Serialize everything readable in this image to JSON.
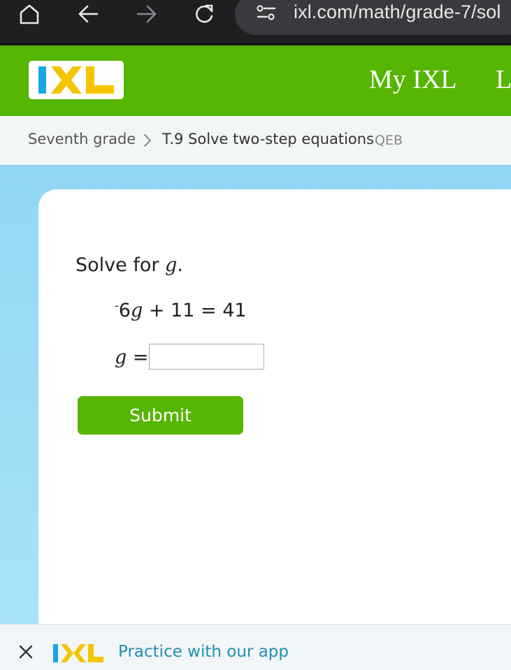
{
  "browser": {
    "url": "ixl.com/math/grade-7/sol",
    "icons": [
      "home-icon",
      "back-icon",
      "forward-icon",
      "reload-icon",
      "site-settings-icon"
    ]
  },
  "header": {
    "logo_text": "IXL",
    "nav_my_ixl": "My IXL",
    "nav_partial": "L",
    "brand_colors": {
      "green": "#56b500",
      "blue": "#1ba4e3",
      "yellow": "#f5c400"
    }
  },
  "breadcrumb": {
    "grade": "Seventh grade",
    "skill": "T.9 Solve two-step equations",
    "code": "QEB"
  },
  "question": {
    "prompt_prefix": "Solve for ",
    "prompt_var": "g",
    "prompt_suffix": ".",
    "eq_sign": "-",
    "eq_coef": "6",
    "eq_var": "g",
    "eq_rest": " + 11 = 41",
    "answer_var": "g",
    "answer_eq": " =",
    "answer_value": "",
    "submit_label": "Submit"
  },
  "app_banner": {
    "text": "Practice with our app"
  }
}
